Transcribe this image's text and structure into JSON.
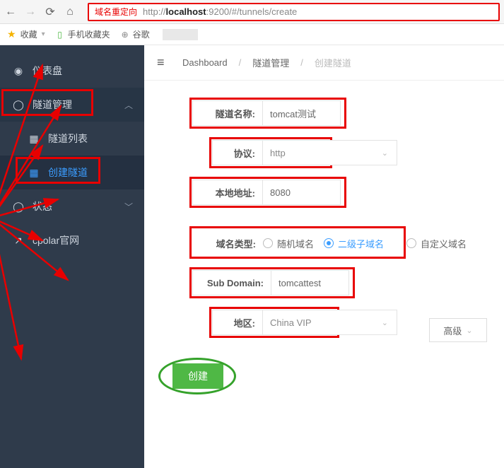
{
  "browser": {
    "redirect_label": "域名重定向",
    "url_prefix": "http://",
    "url_host": "localhost",
    "url_port": ":9200/",
    "url_path": "#/tunnels/create"
  },
  "bookmarks": {
    "favorites": "收藏",
    "mobile_fav": "手机收藏夹",
    "google": "谷歌"
  },
  "sidebar": {
    "dashboard": "仪表盘",
    "tunnel_mgmt": "隧道管理",
    "tunnel_list": "隧道列表",
    "tunnel_create": "创建隧道",
    "status": "状态",
    "cpolar_site": "cpolar官网"
  },
  "breadcrumb": {
    "dashboard": "Dashboard",
    "tunnel_mgmt": "隧道管理",
    "tunnel_create": "创建隧道"
  },
  "form": {
    "name_label": "隧道名称:",
    "name_value": "tomcat测试",
    "proto_label": "协议:",
    "proto_value": "http",
    "addr_label": "本地地址:",
    "addr_value": "8080",
    "domain_label": "域名类型:",
    "domain_random": "随机域名",
    "domain_sub": "二级子域名",
    "domain_custom": "自定义域名",
    "subdomain_label": "Sub Domain:",
    "subdomain_value": "tomcattest",
    "region_label": "地区:",
    "region_value": "China VIP",
    "advanced": "高级",
    "submit": "创建"
  }
}
